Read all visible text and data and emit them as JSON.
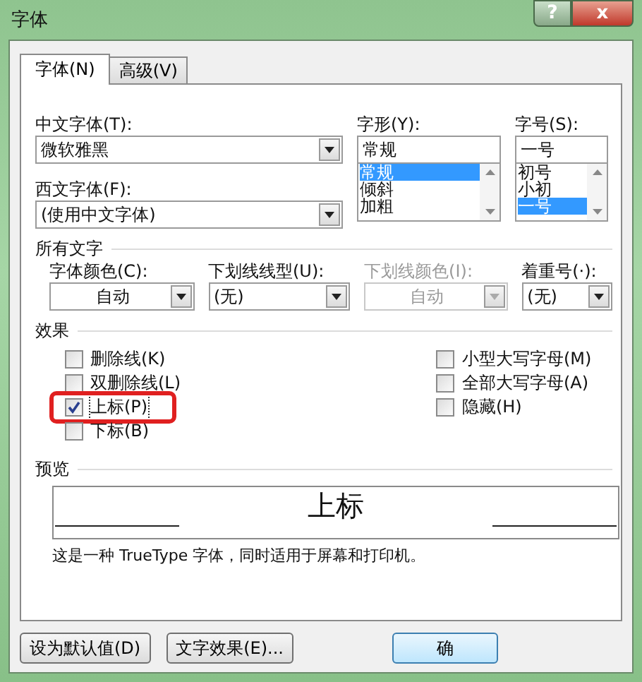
{
  "window": {
    "title": "字体",
    "help": "?",
    "close": "x"
  },
  "tabs": [
    {
      "label": "字体(N)",
      "selected": true
    },
    {
      "label": "高级(V)",
      "selected": false
    }
  ],
  "font_fields": {
    "chinese": {
      "label": "中文字体(T):",
      "value": "微软雅黑"
    },
    "western": {
      "label": "西文字体(F):",
      "value": "(使用中文字体)"
    },
    "style": {
      "label": "字形(Y):",
      "value": "常规",
      "items": [
        {
          "label": "常规",
          "selected": true
        },
        {
          "label": "倾斜",
          "selected": false
        },
        {
          "label": "加粗",
          "selected": false
        }
      ]
    },
    "size": {
      "label": "字号(S):",
      "value": "一号",
      "items": [
        {
          "label": "初号",
          "selected": false
        },
        {
          "label": "小初",
          "selected": false
        },
        {
          "label": "一号",
          "selected": true
        }
      ]
    }
  },
  "all_text": {
    "heading": "所有文字",
    "dropdowns": [
      {
        "label": "字体颜色(C):",
        "value": "自动",
        "disabled": false
      },
      {
        "label": "下划线线型(U):",
        "value": "(无)",
        "disabled": false
      },
      {
        "label": "下划线颜色(I):",
        "value": "自动",
        "disabled": true
      },
      {
        "label": "着重号(·):",
        "value": "(无)",
        "disabled": false
      }
    ]
  },
  "effects": {
    "heading": "效果",
    "left": [
      {
        "label": "删除线(K)",
        "checked": false,
        "highlighted": false
      },
      {
        "label": "双删除线(L)",
        "checked": false,
        "highlighted": false
      },
      {
        "label": "上标(P)",
        "checked": true,
        "highlighted": true
      },
      {
        "label": "下标(B)",
        "checked": false,
        "highlighted": false
      }
    ],
    "right": [
      {
        "label": "小型大写字母(M)",
        "checked": false,
        "highlighted": false
      },
      {
        "label": "全部大写字母(A)",
        "checked": false,
        "highlighted": false
      },
      {
        "label": "隐藏(H)",
        "checked": false,
        "highlighted": false
      }
    ]
  },
  "preview": {
    "heading": "预览",
    "sample": "上标",
    "note": "这是一种 TrueType 字体，同时适用于屏幕和打印机。"
  },
  "buttons": [
    {
      "label": "设为默认值(D)",
      "kind": "left"
    },
    {
      "label": "文字效果(E)...",
      "kind": "left"
    },
    {
      "label": "确",
      "kind": "right"
    }
  ]
}
